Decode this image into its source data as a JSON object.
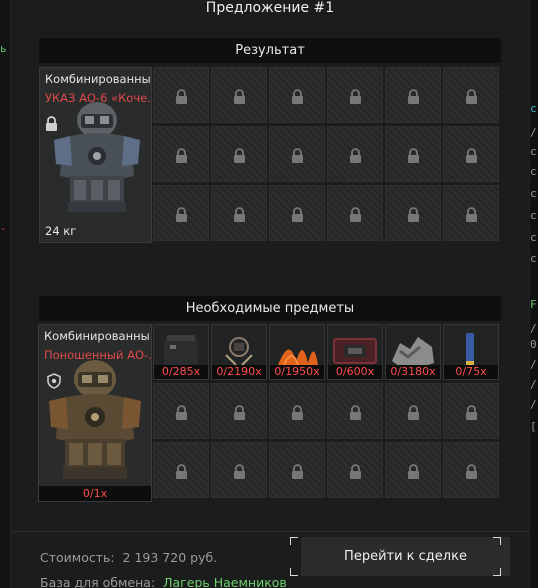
{
  "modal": {
    "title": "Предложение #1"
  },
  "result": {
    "header": "Результат",
    "item": {
      "name": "Комбинированны..",
      "subname": "УКАЗ АО-6 «Коче..",
      "weight": "24 кг",
      "icon": "armor-vest-icon",
      "locked": true
    },
    "grid_rows": 3,
    "grid_cols": 6
  },
  "required": {
    "header": "Необходимые предметы",
    "item": {
      "name": "Комбинированны..",
      "subname": "Поношенный АО-..",
      "count": "0/1x",
      "icon": "armor-vest-icon"
    },
    "materials": [
      {
        "icon": "metal-box-icon",
        "count": "0/285x"
      },
      {
        "icon": "wire-spool-icon",
        "count": "0/2190x"
      },
      {
        "icon": "orange-fiber-icon",
        "count": "0/1950x"
      },
      {
        "icon": "circuit-board-icon",
        "count": "0/600x"
      },
      {
        "icon": "scrap-metal-icon",
        "count": "0/3180x"
      },
      {
        "icon": "cartridge-icon",
        "count": "0/75x"
      }
    ]
  },
  "footer": {
    "cost_label": "Стоимость:",
    "cost_value": "2 193 720 руб.",
    "base_label": "База для обмена:",
    "base_value": "Лагерь Наемников",
    "deal_button": "Перейти к сделке"
  },
  "colors": {
    "modal_bg": "#1b1c1c",
    "header_bg": "#0f0f0f",
    "missing_count": "#ff4c4c",
    "subname_red": "#e04a4a",
    "base_green": "#6fd06f"
  }
}
